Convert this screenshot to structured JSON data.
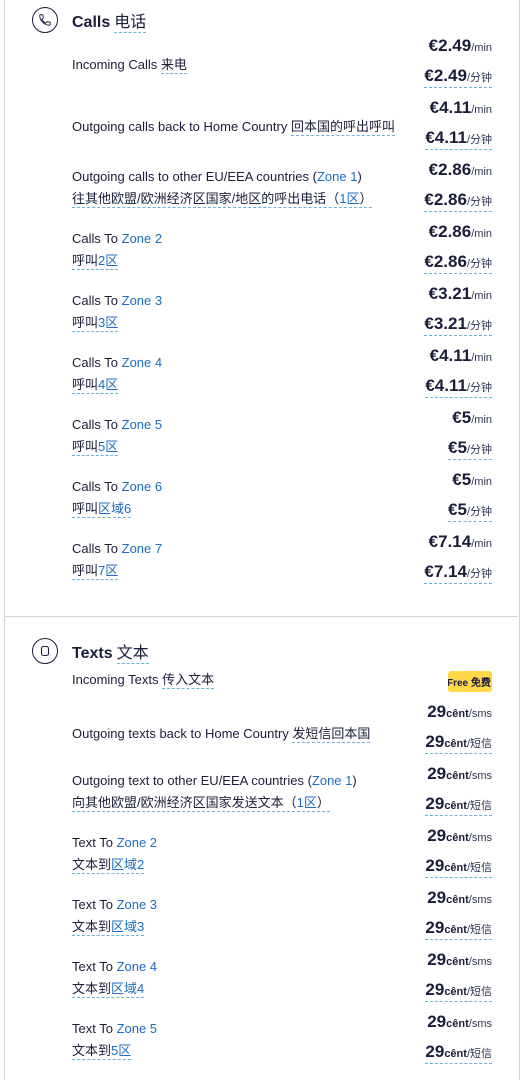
{
  "calls": {
    "title_en": "Calls",
    "title_cn": "电话",
    "unit_min": "/min",
    "unit_cn": "/分钟",
    "rows": [
      {
        "l1_pre": "Incoming Calls ",
        "l1_cn": "来电",
        "l1_zone": "",
        "l1_post": "",
        "l2_pre": "",
        "l2_zone": "",
        "l2_post": "",
        "price": "€2.49"
      },
      {
        "l1_pre": "Outgoing calls back to Home Country ",
        "l1_cn": "回本国的呼出呼叫",
        "l1_zone": "",
        "l1_post": "",
        "l2_pre": "",
        "l2_zone": "",
        "l2_post": "",
        "price": "€4.11"
      },
      {
        "l1_pre": "Outgoing calls to other EU/EEA countries (",
        "l1_cn": "",
        "l1_zone": "Zone 1",
        "l1_post": ")",
        "l2_pre": "往其他欧盟/欧洲经济区国家/地区的呼出电话（",
        "l2_zone": "1区",
        "l2_post": "）",
        "price": "€2.86"
      },
      {
        "l1_pre": "Calls To ",
        "l1_cn": "",
        "l1_zone": "Zone 2",
        "l1_post": "",
        "l2_pre": "呼叫",
        "l2_zone": "2区",
        "l2_post": "",
        "price": "€2.86"
      },
      {
        "l1_pre": "Calls To ",
        "l1_cn": "",
        "l1_zone": "Zone 3",
        "l1_post": "",
        "l2_pre": "呼叫",
        "l2_zone": "3区",
        "l2_post": "",
        "price": "€3.21"
      },
      {
        "l1_pre": "Calls To ",
        "l1_cn": "",
        "l1_zone": "Zone 4",
        "l1_post": "",
        "l2_pre": "呼叫",
        "l2_zone": "4区",
        "l2_post": "",
        "price": "€4.11"
      },
      {
        "l1_pre": "Calls To ",
        "l1_cn": "",
        "l1_zone": "Zone 5",
        "l1_post": "",
        "l2_pre": "呼叫",
        "l2_zone": "5区",
        "l2_post": "",
        "price": "€5"
      },
      {
        "l1_pre": "Calls To ",
        "l1_cn": "",
        "l1_zone": "Zone 6",
        "l1_post": "",
        "l2_pre": "呼叫",
        "l2_zone": "区域6",
        "l2_post": "",
        "price": "€5"
      },
      {
        "l1_pre": "Calls To ",
        "l1_cn": "",
        "l1_zone": "Zone 7",
        "l1_post": "",
        "l2_pre": "呼叫",
        "l2_zone": "7区",
        "l2_post": "",
        "price": "€7.14"
      }
    ]
  },
  "texts": {
    "title_en": "Texts",
    "title_cn": "文本",
    "unit_sms": "/sms",
    "unit_cn": "/短信",
    "cent": "cênt",
    "incoming": {
      "pre": "Incoming Texts ",
      "cn": "传入文本",
      "badge": "Free 免费"
    },
    "rows": [
      {
        "l1_pre": "Outgoing texts back to Home Country ",
        "l1_cn": "发短信回本国",
        "l1_zone": "",
        "l1_post": "",
        "l2_pre": "",
        "l2_zone": "",
        "l2_post": "",
        "price": "29"
      },
      {
        "l1_pre": "Outgoing text to other EU/EEA countries (",
        "l1_cn": "",
        "l1_zone": "Zone 1",
        "l1_post": ")",
        "l2_pre": "向其他欧盟/欧洲经济区国家发送文本（",
        "l2_zone": "1区",
        "l2_post": "）",
        "price": "29"
      },
      {
        "l1_pre": "Text To ",
        "l1_cn": "",
        "l1_zone": "Zone 2",
        "l1_post": "",
        "l2_pre": "文本到",
        "l2_zone": "区域2",
        "l2_post": "",
        "price": "29"
      },
      {
        "l1_pre": "Text To ",
        "l1_cn": "",
        "l1_zone": "Zone 3",
        "l1_post": "",
        "l2_pre": "文本到",
        "l2_zone": "区域3",
        "l2_post": "",
        "price": "29"
      },
      {
        "l1_pre": "Text To ",
        "l1_cn": "",
        "l1_zone": "Zone 4",
        "l1_post": "",
        "l2_pre": "文本到",
        "l2_zone": "区域4",
        "l2_post": "",
        "price": "29"
      },
      {
        "l1_pre": "Text To ",
        "l1_cn": "",
        "l1_zone": "Zone 5",
        "l1_post": "",
        "l2_pre": "文本到",
        "l2_zone": "5区",
        "l2_post": "",
        "price": "29"
      }
    ]
  }
}
